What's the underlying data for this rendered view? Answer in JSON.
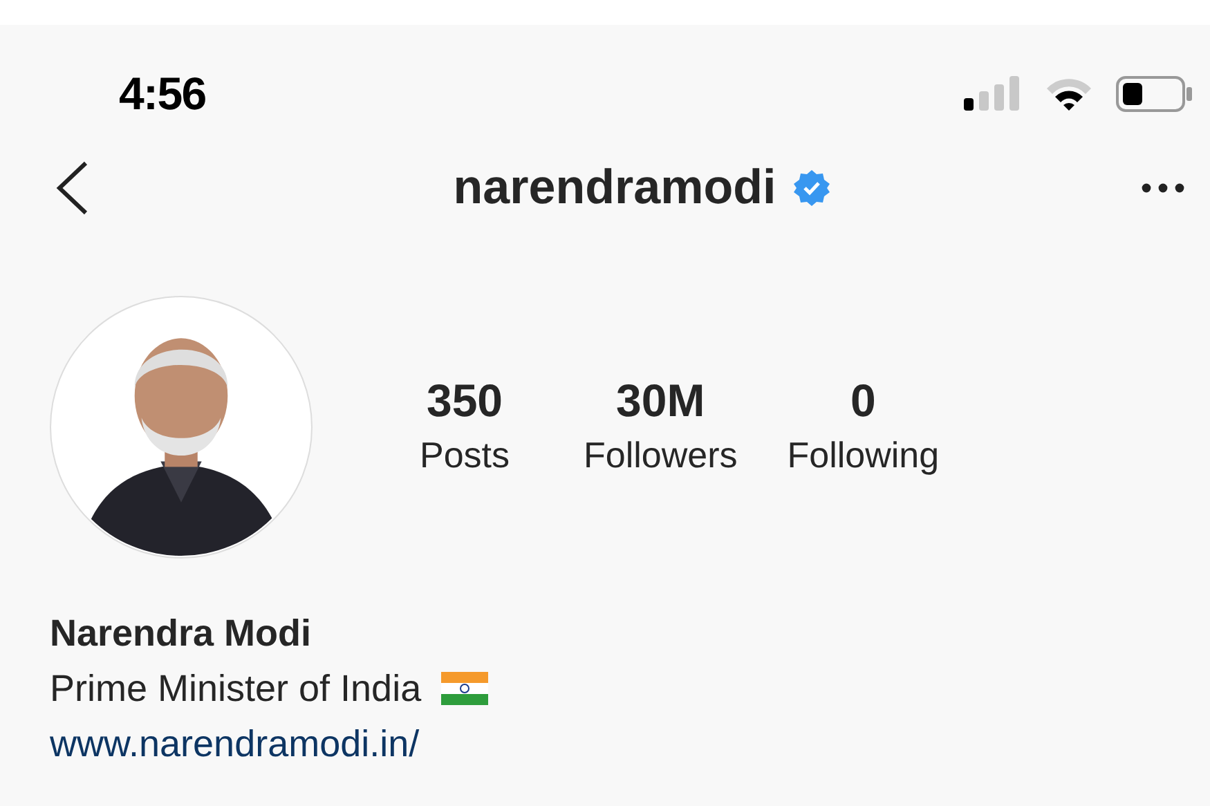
{
  "status_bar": {
    "time": "4:56"
  },
  "header": {
    "username": "narendramodi",
    "verified": true
  },
  "stats": [
    {
      "value": "350",
      "label": "Posts"
    },
    {
      "value": "30M",
      "label": "Followers"
    },
    {
      "value": "0",
      "label": "Following"
    }
  ],
  "bio": {
    "name": "Narendra Modi",
    "description": "Prime Minister of India",
    "link": "www.narendramodi.in/"
  }
}
